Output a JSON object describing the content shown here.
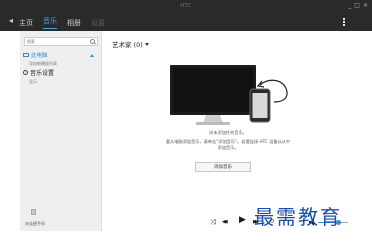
{
  "window": {
    "title": "HTC",
    "controls": {
      "minimize": "_",
      "maximize": "□",
      "close": "×"
    }
  },
  "nav": {
    "back_icon": "back-arrow-icon",
    "items": [
      {
        "label": "主页",
        "state": "normal"
      },
      {
        "label": "音乐",
        "state": "active"
      },
      {
        "label": "相册",
        "state": "normal"
      },
      {
        "label": "设置",
        "state": "disabled"
      }
    ],
    "menu_icon": "vertical-dots-icon"
  },
  "sidebar": {
    "search": {
      "placeholder": "搜索"
    },
    "computer_section": {
      "label": "此电脑",
      "icon": "computer-icon",
      "sub_item": "添加新播放列表"
    },
    "settings_section": {
      "label": "音乐设置",
      "icon": "gear-icon",
      "sub_item": "显示"
    },
    "device_label": "未连接手机"
  },
  "main": {
    "header": "艺术家 (0)",
    "empty_title": "尚未添加任何音乐。",
    "empty_line1": "要从电脑添加音乐，请单击“添加音乐”。若要连接 HTC 设备以从中",
    "empty_line2": "添加音乐。",
    "add_button": "添加音乐"
  },
  "player": {
    "shuffle": "⤨",
    "prev": "◀◀",
    "play": "▶",
    "next": "▶▶",
    "repeat": "⟲",
    "volume_icon": "speaker-icon",
    "volume_level": 0.65
  },
  "watermark": {
    "text": "最需教育"
  },
  "colors": {
    "accent": "#3ea3e8",
    "topbar": "#2a2a2a",
    "sidebar": "#efefef",
    "watermark": "#1c4da8"
  }
}
